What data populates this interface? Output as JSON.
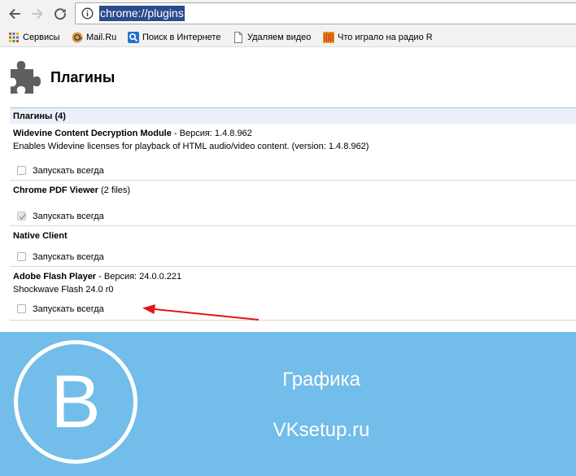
{
  "toolbar": {
    "url": "chrome://plugins"
  },
  "bookmarks": [
    {
      "label": "Сервисы",
      "icon": "apps-grid-icon"
    },
    {
      "label": "Mail.Ru",
      "icon": "mailru-icon"
    },
    {
      "label": "Поиск в Интернете",
      "icon": "search-icon"
    },
    {
      "label": "Удаляем видео",
      "icon": "page-icon"
    },
    {
      "label": "Что играло на радио R",
      "icon": "radio-icon"
    }
  ],
  "page": {
    "title": "Плагины",
    "section_header": "Плагины (4)"
  },
  "plugins": [
    {
      "name": "Widevine Content Decryption Module",
      "version_text": " - Версия: 1.4.8.962",
      "description": "Enables Widevine licenses for playback of HTML audio/video content. (version: 1.4.8.962)",
      "always_run_label": "Запускать всегда",
      "checked": false
    },
    {
      "name": "Chrome PDF Viewer",
      "version_text": " (2 files)",
      "description": "",
      "always_run_label": "Запускать всегда",
      "checked": true
    },
    {
      "name": "Native Client",
      "version_text": "",
      "description": "",
      "always_run_label": "Запускать всегда",
      "checked": false
    },
    {
      "name": "Adobe Flash Player",
      "version_text": " - Версия: 24.0.0.221",
      "description": "Shockwave Flash 24.0 r0",
      "always_run_label": "Запускать всегда",
      "checked": false
    }
  ],
  "banner": {
    "logo_letter": "B",
    "caption": "Графика",
    "site": "VKsetup.ru",
    "background": "#72bde9"
  }
}
